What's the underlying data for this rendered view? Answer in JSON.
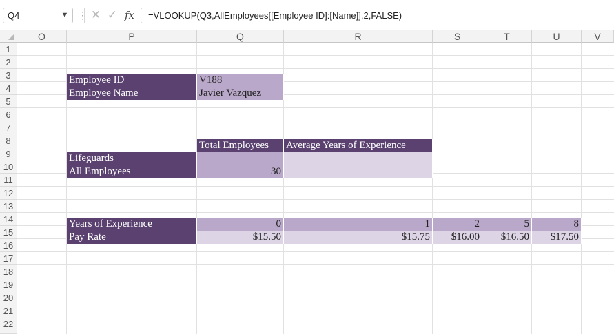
{
  "formula_bar": {
    "name_box": "Q4",
    "formula": "=VLOOKUP(Q3,AllEmployees[[Employee ID]:[Name]],2,FALSE)",
    "cancel_icon": "close-icon",
    "enter_icon": "check-icon",
    "function_icon": "fx-icon"
  },
  "columns": [
    "O",
    "P",
    "Q",
    "R",
    "S",
    "T",
    "U",
    "V"
  ],
  "rows": [
    "1",
    "2",
    "3",
    "4",
    "5",
    "6",
    "7",
    "8",
    "9",
    "10",
    "11",
    "12",
    "13",
    "14",
    "15",
    "16",
    "17",
    "18",
    "19",
    "20",
    "21",
    "22"
  ],
  "lookup": {
    "employee_id_label": "Employee ID",
    "employee_id_value": "V188",
    "employee_name_label": "Employee Name",
    "employee_name_value": "Javier Vazquez"
  },
  "summary": {
    "total_employees_header": "Total Employees",
    "avg_years_header": "Average Years of Experience",
    "lifeguards_label": "Lifeguards",
    "lifeguards_total": "",
    "lifeguards_avg": "",
    "all_employees_label": "All Employees",
    "all_employees_total": "30",
    "all_employees_avg": ""
  },
  "pay_table": {
    "years_label": "Years of Experience",
    "pay_label": "Pay Rate",
    "years": [
      "0",
      "1",
      "2",
      "5",
      "8"
    ],
    "rates": [
      "$15.50",
      "$15.75",
      "$16.00",
      "$16.50",
      "$17.50"
    ]
  },
  "colors": {
    "header_fill": "#5a4170",
    "mid_fill": "#b9a8c9",
    "light_fill": "#ddd5e6"
  }
}
